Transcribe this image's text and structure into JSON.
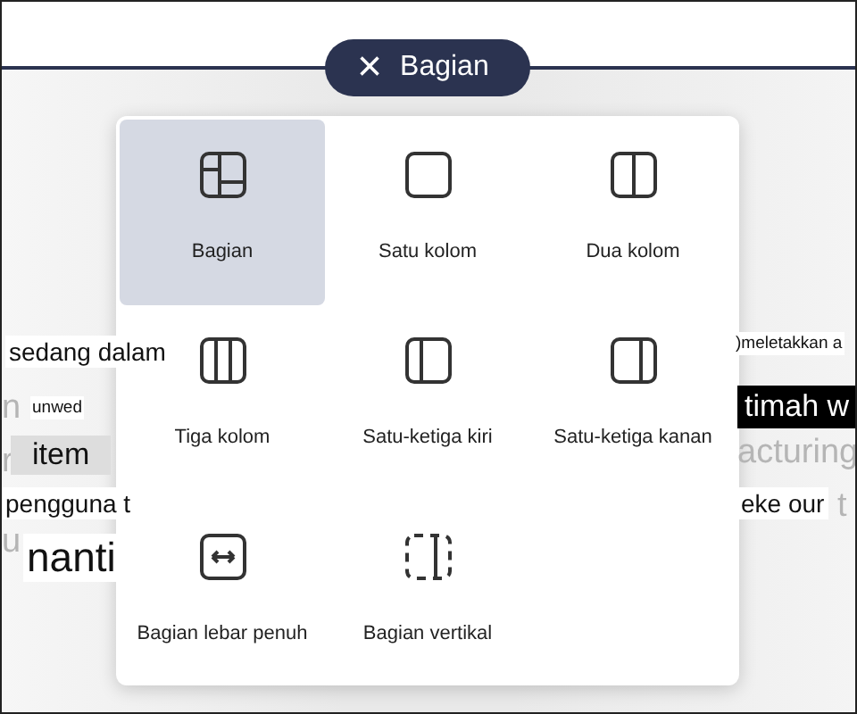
{
  "background_fragments": [
    {
      "text": "sedang dalam",
      "kind": "plain"
    },
    {
      "text": "n",
      "kind": "faded"
    },
    {
      "text": "unwed",
      "kind": "small"
    },
    {
      "text": "r",
      "kind": "faded"
    },
    {
      "text": "item",
      "kind": "chip"
    },
    {
      "text": "pengguna t",
      "kind": "plain"
    },
    {
      "text": "u",
      "kind": "faded"
    },
    {
      "text": "nanti",
      "kind": "large"
    },
    {
      "text": ")meletakkan a",
      "kind": "small"
    },
    {
      "text": "timah w",
      "kind": "inverted"
    },
    {
      "text": "acturing",
      "kind": "faded"
    },
    {
      "text": "eke our",
      "kind": "plain"
    },
    {
      "text": "t",
      "kind": "faded"
    }
  ],
  "section_pill": {
    "close": "×",
    "label": "Bagian"
  },
  "layouts": [
    {
      "label": "Bagian",
      "kind": "mixed",
      "selected": true
    },
    {
      "label": "Satu kolom",
      "kind": "one",
      "selected": false
    },
    {
      "label": "Dua kolom",
      "kind": "two",
      "selected": false
    },
    {
      "label": "Tiga kolom",
      "kind": "three",
      "selected": false
    },
    {
      "label": "Satu-ketiga kiri",
      "kind": "third-left",
      "selected": false
    },
    {
      "label": "Satu-ketiga kanan",
      "kind": "third-right",
      "selected": false
    },
    {
      "label": "Bagian lebar penuh",
      "kind": "full",
      "selected": false
    },
    {
      "label": "Bagian vertikal",
      "kind": "vertical",
      "selected": false
    }
  ]
}
